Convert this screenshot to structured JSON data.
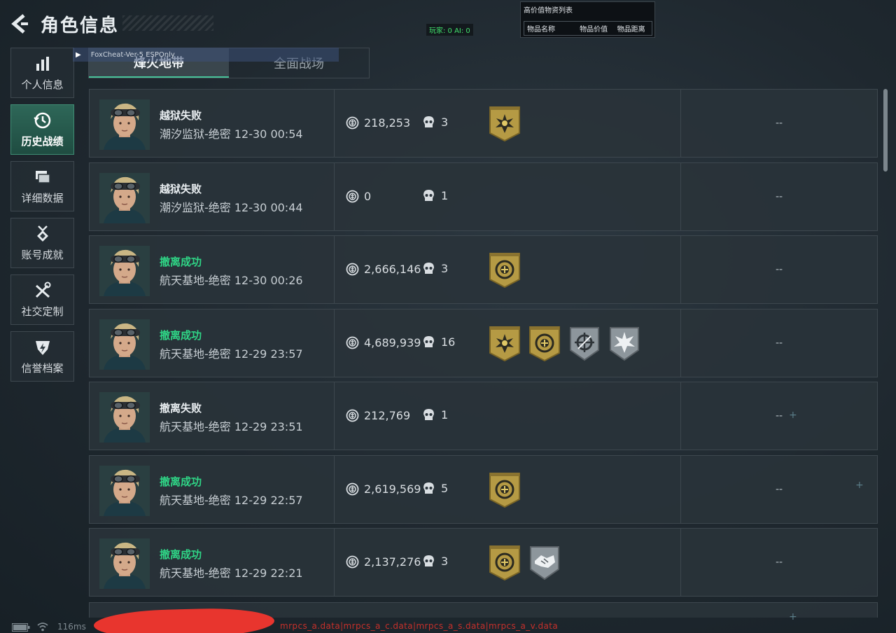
{
  "header": {
    "title": "角色信息"
  },
  "overlay": {
    "counter_text": "玩家: 0  AI: 0",
    "cheat_label": "FoxCheat-Ver-5 ESPOnly",
    "high_value_panel": {
      "title": "高价值物资列表",
      "columns": [
        "物品名称",
        "物品价值",
        "物品距离"
      ]
    },
    "debug_text": "mrpcs_a.data|mrpcs_a_c.data|mrpcs_a_s.data|mrpcs_a_v.data",
    "latency": "116ms"
  },
  "sidebar": {
    "items": [
      {
        "label": "个人信息",
        "icon": "bar-chart-icon",
        "active": false
      },
      {
        "label": "历史战绩",
        "icon": "clock-history-icon",
        "active": true
      },
      {
        "label": "详细数据",
        "icon": "cards-icon",
        "active": false
      },
      {
        "label": "账号成就",
        "icon": "medal-icon",
        "active": false
      },
      {
        "label": "社交定制",
        "icon": "tools-icon",
        "active": false
      },
      {
        "label": "信誉档案",
        "icon": "shield-lightning-icon",
        "active": false
      }
    ]
  },
  "tabs": [
    {
      "label": "烽火地带",
      "active": true
    },
    {
      "label": "全面战场",
      "active": false
    }
  ],
  "colors": {
    "success": "#2fd586",
    "accent": "#48c39a",
    "badge_gold": "#b59a44",
    "badge_gray": "#8d969c"
  },
  "records": [
    {
      "result": "越狱失败",
      "success": false,
      "map_time": "潮汐监狱-绝密 12-30 00:54",
      "value": "218,253",
      "kills": "3",
      "badges": [
        "gold-star-badge"
      ],
      "extra": "--"
    },
    {
      "result": "越狱失败",
      "success": false,
      "map_time": "潮汐监狱-绝密 12-30 00:44",
      "value": "0",
      "kills": "1",
      "badges": [],
      "extra": "--"
    },
    {
      "result": "撤离成功",
      "success": true,
      "map_time": "航天基地-绝密 12-30 00:26",
      "value": "2,666,146",
      "kills": "3",
      "badges": [
        "gold-wreath-badge"
      ],
      "extra": "--"
    },
    {
      "result": "撤离成功",
      "success": true,
      "map_time": "航天基地-绝密 12-29 23:57",
      "value": "4,689,939",
      "kills": "16",
      "badges": [
        "gold-star-badge",
        "gold-wreath-badge",
        "gray-crosshair-badge",
        "gray-burst-badge"
      ],
      "extra": "--"
    },
    {
      "result": "撤离失败",
      "success": false,
      "map_time": "航天基地-绝密 12-29 23:51",
      "value": "212,769",
      "kills": "1",
      "badges": [],
      "extra": "--"
    },
    {
      "result": "撤离成功",
      "success": true,
      "map_time": "航天基地-绝密 12-29 22:57",
      "value": "2,619,569",
      "kills": "5",
      "badges": [
        "gold-wreath-badge"
      ],
      "extra": "--"
    },
    {
      "result": "撤离成功",
      "success": true,
      "map_time": "航天基地-绝密 12-29 22:21",
      "value": "2,137,276",
      "kills": "3",
      "badges": [
        "gold-wreath-badge",
        "gray-handshake-badge"
      ],
      "extra": "--"
    }
  ]
}
